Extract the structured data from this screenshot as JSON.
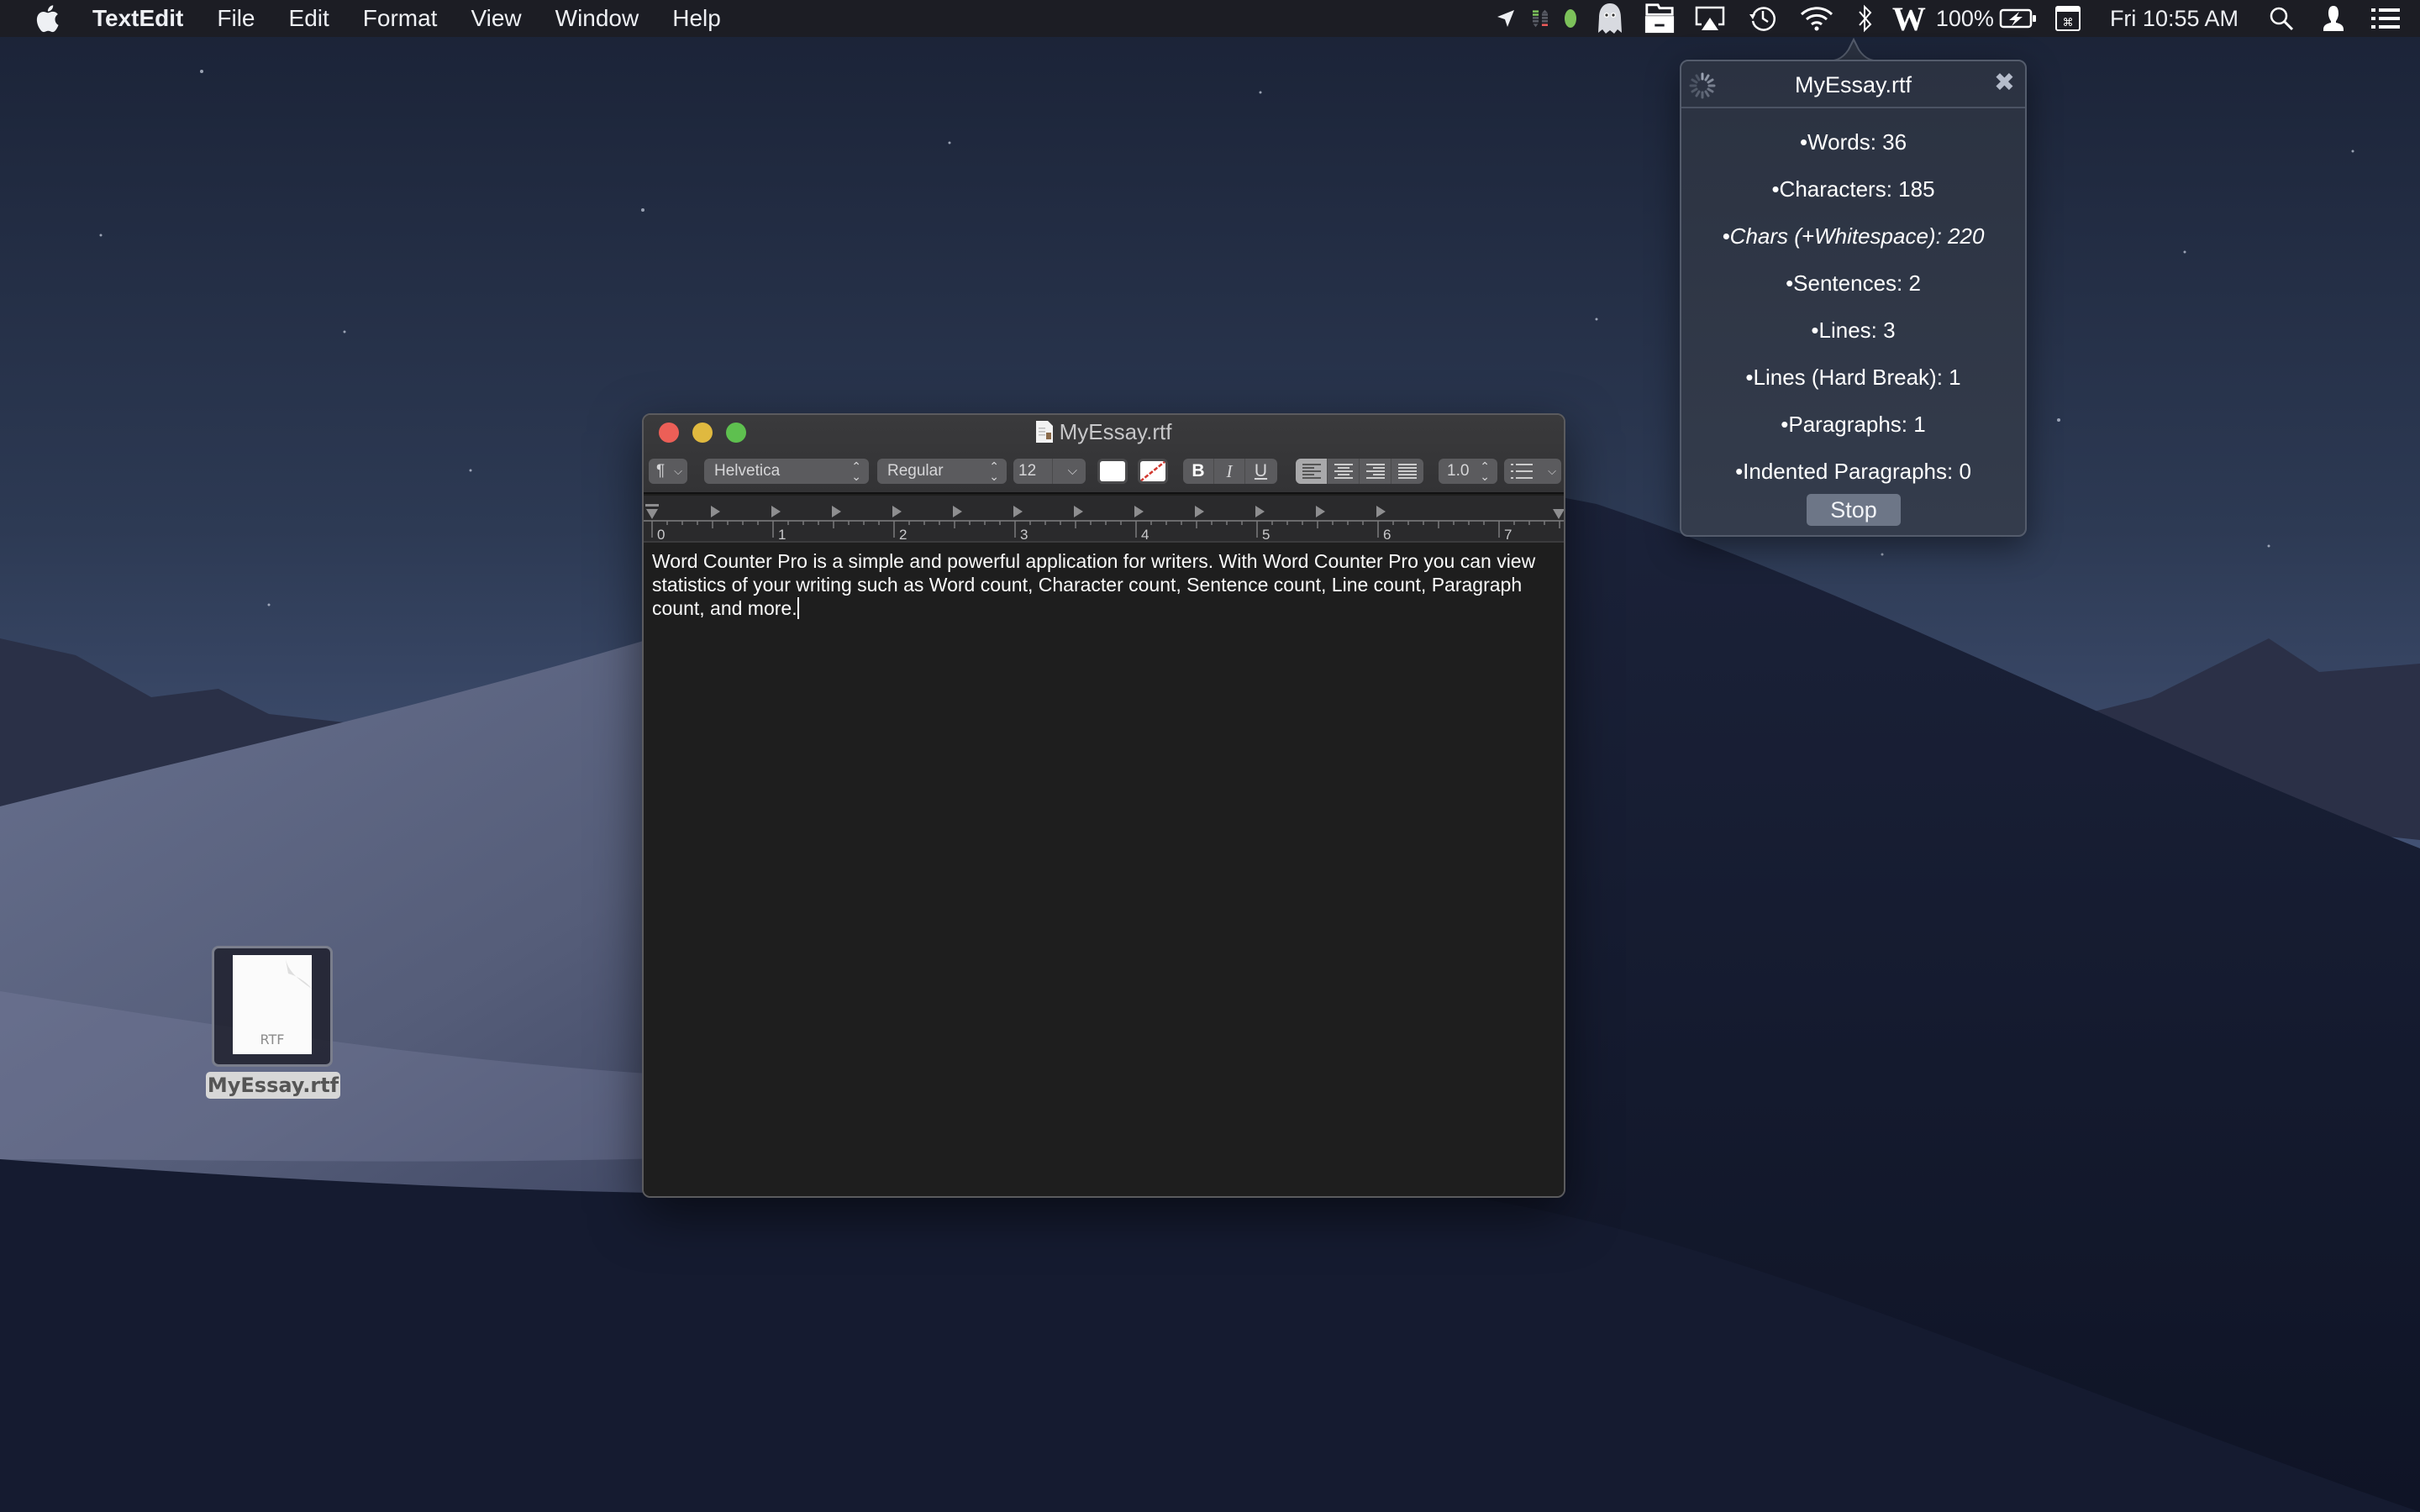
{
  "menubar": {
    "app_name": "TextEdit",
    "menus": [
      "File",
      "Edit",
      "Format",
      "View",
      "Window",
      "Help"
    ],
    "status": {
      "battery_percent": "100%",
      "clock": "Fri 10:55 AM",
      "word_counter_icon_letter": "W"
    }
  },
  "desktop": {
    "file_icon": {
      "name": "MyEssay.rtf",
      "type_label": "RTF"
    }
  },
  "window": {
    "title": "MyEssay.rtf",
    "toolbar": {
      "paragraph_style_glyph": "¶",
      "font_family": "Helvetica",
      "font_style": "Regular",
      "font_size": "12",
      "bold": "B",
      "italic": "I",
      "underline": "U",
      "line_spacing": "1.0",
      "alignment_selected": "left"
    },
    "ruler": {
      "labels": [
        "0",
        "1",
        "2",
        "3",
        "4",
        "5",
        "6",
        "7"
      ]
    },
    "document_text": "Word Counter Pro is a simple and powerful application for writers. With Word Counter Pro you can view statistics of your writing such as Word count, Character count, Sentence count, Line count, Paragraph count, and more."
  },
  "popover": {
    "title": "MyEssay.rtf",
    "stats": [
      {
        "label": "•Words: 36",
        "italic": false
      },
      {
        "label": "•Characters: 185",
        "italic": false
      },
      {
        "label": "•Chars (+Whitespace): 220",
        "italic": true
      },
      {
        "label": "•Sentences: 2",
        "italic": false
      },
      {
        "label": "•Lines: 3",
        "italic": false
      },
      {
        "label": "•Lines (Hard Break): 1",
        "italic": false
      },
      {
        "label": "•Paragraphs: 1",
        "italic": false
      },
      {
        "label": "•Indented Paragraphs: 0",
        "italic": false
      }
    ],
    "stop_label": "Stop"
  },
  "colors": {
    "close": "#ec5f57",
    "minimize": "#e0b93f",
    "maximize": "#5ec04f",
    "status_green": "#7cc15a",
    "level_red": "#e95a5a"
  }
}
